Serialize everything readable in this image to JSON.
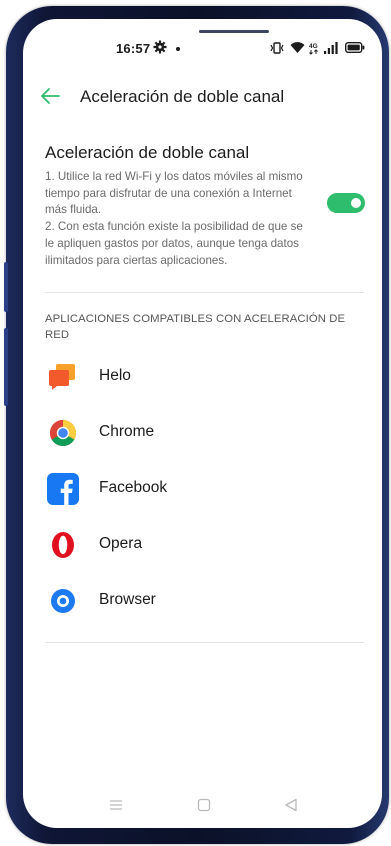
{
  "status_bar": {
    "time": "16:57"
  },
  "header": {
    "title": "Aceleración de doble canal"
  },
  "feature": {
    "title": "Aceleración de doble canal",
    "description": "1. Utilice la red Wi-Fi y los datos móviles al mismo tiempo para disfrutar de una conexión a Internet más fluida.\n2. Con esta función existe la posibilidad de que se le apliquen gastos por datos, aunque tenga datos ilimitados para ciertas aplicaciones.",
    "toggle_on": true
  },
  "apps_section": {
    "label": "APLICACIONES COMPATIBLES CON ACELERACIÓN DE RED",
    "apps": [
      {
        "name": "Helo",
        "icon": "helo-icon"
      },
      {
        "name": "Chrome",
        "icon": "chrome-icon"
      },
      {
        "name": "Facebook",
        "icon": "facebook-icon"
      },
      {
        "name": "Opera",
        "icon": "opera-icon"
      },
      {
        "name": "Browser",
        "icon": "browser-icon"
      }
    ]
  },
  "colors": {
    "accent": "#2ebd6c",
    "facebook": "#1877f2",
    "opera": "#e0101f",
    "browser": "#1d7af0",
    "helo": "#f25a2c"
  },
  "nav_bar": {
    "buttons": [
      "menu-icon",
      "home-icon",
      "back-triangle-icon"
    ]
  }
}
